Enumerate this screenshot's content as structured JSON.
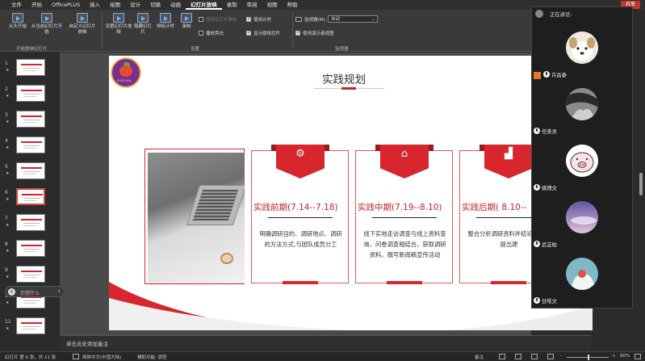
{
  "menu": {
    "items": [
      "文件",
      "开始",
      "OfficePLUS",
      "插入",
      "绘图",
      "设计",
      "切换",
      "动画",
      "幻灯片放映",
      "录制",
      "审阅",
      "视图",
      "帮助"
    ],
    "active_index": 8,
    "share_label": "共享"
  },
  "ribbon": {
    "from_start": "从头开始",
    "from_current": "从当前幻灯片开始",
    "custom_show": "自定义幻灯片放映",
    "group_start": "开始放映幻灯片",
    "setup_show": "设置幻灯片放映",
    "hide_slide": "隐藏幻灯片",
    "rehearse": "排练计时",
    "record": "录制",
    "keep_timings": "保持幻灯片更新",
    "play_narration": "播放旁白",
    "use_timings": "使用计时",
    "show_media": "显示媒体控件",
    "group_setup": "设置",
    "monitor_label": "监视器(M):",
    "monitor_value": "自动",
    "presenter_view": "使用演示者视图",
    "group_monitors": "监视器"
  },
  "thumbnails": {
    "numbers": [
      "1",
      "2",
      "3",
      "4",
      "5",
      "6",
      "7",
      "8",
      "9",
      "10",
      "11"
    ],
    "star": "★",
    "selected_index": 5
  },
  "slide": {
    "logo_text": "SUOCHAI",
    "title": "实践规划",
    "cards": [
      {
        "icon": "gear-icon",
        "glyph": "⚙",
        "heading": "实践前期(7.14--7.18)",
        "body": "明确调研目的、调研地点、调研的方法方式,与团队成员分工"
      },
      {
        "icon": "home-icon",
        "glyph": "⌂",
        "heading": "实践中期(7.19--8.10)",
        "body": "线下实地走访调查与线上资料查询、问卷调查相结合，获取调研资料。撰写新闻稿宣传活动"
      },
      {
        "icon": "chart-icon",
        "glyph": "▟",
        "heading": "实践后期( 8.10--",
        "body": "整合分析调研资料并结论，并且提出建"
      }
    ]
  },
  "notes": {
    "placeholder": "单击此处添加备注"
  },
  "float_tool": {
    "placeholder": "您想什么"
  },
  "status": {
    "slide_info": "幻灯片 第 6 张，共 11 张",
    "language": "简体中文(中国大陆)",
    "accessibility": "辅助功能: 调查",
    "notes_btn": "备注",
    "zoom": "90%",
    "minus": "-",
    "plus": "+"
  },
  "meeting": {
    "speaking_label": "正在讲话:",
    "participants": [
      {
        "name": "许昌泰",
        "avatar": "dog-avatar",
        "host": true
      },
      {
        "name": "任美灵",
        "avatar": "bw-photo-avatar",
        "host": false
      },
      {
        "name": "姚博文",
        "avatar": "pig-avatar",
        "host": false
      },
      {
        "name": "武芸柏",
        "avatar": "sky-avatar",
        "host": false
      },
      {
        "name": "甘皓文",
        "avatar": "illustration-avatar",
        "host": false
      }
    ]
  },
  "colors": {
    "accent_red": "#d7262d",
    "ribbon_bg": "#3a3a3a",
    "panel_bg": "#2b2b2b"
  }
}
